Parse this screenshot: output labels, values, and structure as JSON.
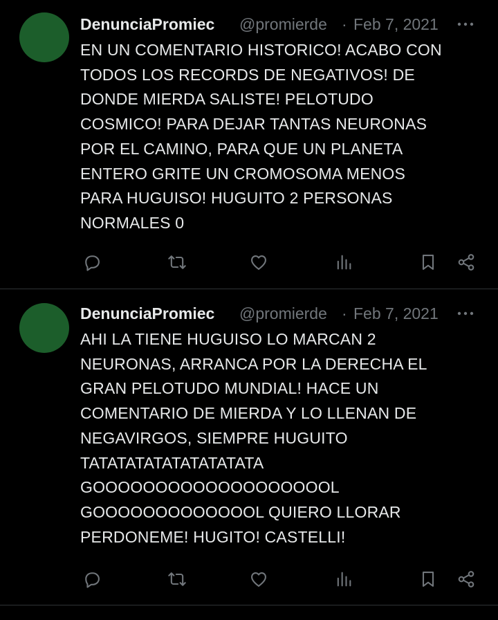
{
  "colors": {
    "background": "#000000",
    "text_primary": "#e7e9ea",
    "text_secondary": "#71767b",
    "divider": "#2f3336",
    "avatar": "#1c5e2b"
  },
  "icons": {
    "more": "more-horizontal-icon",
    "reply": "reply-bubble-icon",
    "retweet": "retweet-icon",
    "like": "heart-icon",
    "views": "views-bars-icon",
    "bookmark": "bookmark-icon",
    "share": "share-icon"
  },
  "tweets": [
    {
      "display_name": "DenunciaPromiec",
      "handle": "@promierde",
      "separator": "·",
      "date": "Feb 7, 2021",
      "text_lines": [
        "EN UN COMENTARIO HISTORICO! ACABO CON",
        "TODOS LOS RECORDS DE NEGATIVOS! DE",
        "DONDE MIERDA SALISTE! PELOTUDO",
        "COSMICO! PARA DEJAR TANTAS NEURONAS",
        "POR EL CAMINO, PARA QUE UN PLANETA",
        "ENTERO GRITE UN CROMOSOMA MENOS",
        "PARA HUGUISO! HUGUITO 2 PERSONAS",
        "NORMALES 0"
      ]
    },
    {
      "display_name": "DenunciaPromiec",
      "handle": "@promierde",
      "separator": "·",
      "date": "Feb 7, 2021",
      "text_lines": [
        "AHI LA TIENE HUGUISO LO MARCAN 2",
        "NEURONAS, ARRANCA POR LA DERECHA EL",
        "GRAN PELOTUDO MUNDIAL! HACE UN",
        "COMENTARIO DE MIERDA Y LO LLENAN DE",
        "NEGAVIRGOS, SIEMPRE HUGUITO",
        "TATATATATATATATATATA",
        "GOOOOOOOOOOOOOOOOOOOL",
        "GOOOOOOOOOOOOOL QUIERO LLORAR",
        "PERDONEME! HUGITO! CASTELLI!"
      ]
    }
  ]
}
